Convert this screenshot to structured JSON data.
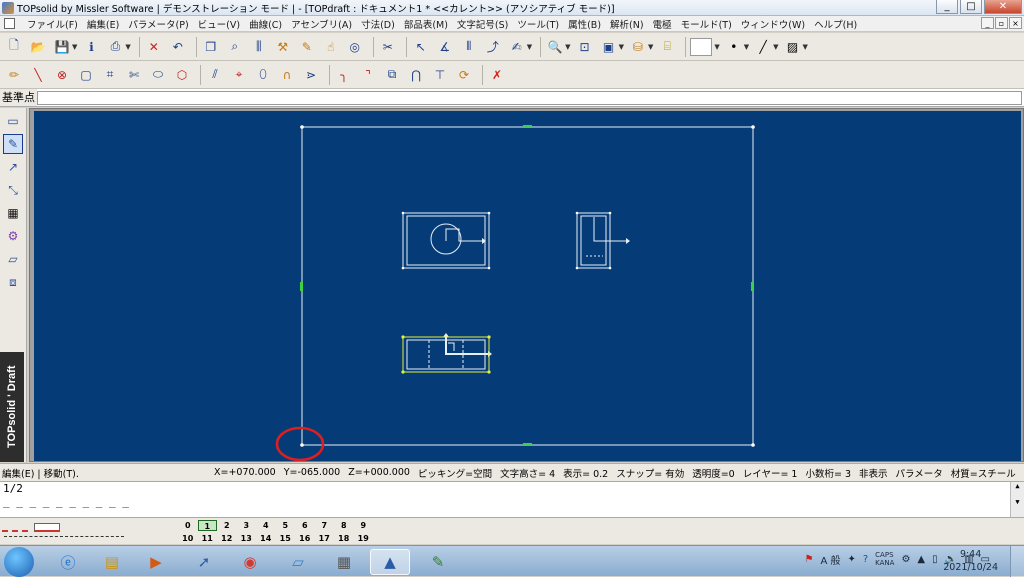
{
  "window": {
    "title": "TOPsolid by Missler Software | デモンストレーション モード | - [TOPdraft : ドキュメント1 *  <<カレント>> (アソシアティブ モード)]",
    "buttons": [
      "_",
      "□",
      "✕"
    ]
  },
  "menu": {
    "items": [
      "ファイル(F)",
      "編集(E)",
      "パラメータ(P)",
      "ビュー(V)",
      "曲線(C)",
      "アセンブリ(A)",
      "寸法(D)",
      "部品表(M)",
      "文字記号(S)",
      "ツール(T)",
      "属性(B)",
      "解析(N)",
      "電極",
      "モールド(T)",
      "ウィンドウ(W)",
      "ヘルプ(H)"
    ],
    "mdi_buttons": [
      "_",
      "▫",
      "×"
    ]
  },
  "toolbar1": {
    "icons": [
      "new-icon",
      "open-icon",
      "save-icon",
      "properties-icon",
      "print-icon",
      "delete-icon",
      "undo-icon",
      "copy-icon",
      "search-icon",
      "parameters-icon",
      "hammer-icon",
      "dimension-icon",
      "cursor-icon",
      "orbit-icon",
      "transform-icon",
      "line-icon",
      "angle-icon",
      "pins-icon",
      "hook-icon",
      "signature-icon",
      "zoom-icon",
      "frame-icon",
      "picture-icon",
      "view-icon",
      "cylinder-icon"
    ]
  },
  "toolbar2": {
    "icons": [
      "pencil-icon",
      "line-draw-icon",
      "circle-x-icon",
      "rectangle-icon",
      "crop-icon",
      "cut-icon",
      "ellipse-icon",
      "polygon-icon",
      "parallel-icon",
      "target-icon",
      "slot-icon",
      "arc-icon",
      "chamfer-icon",
      "fillet-icon",
      "corner-icon",
      "offset-icon",
      "bridge-icon",
      "trim-icon",
      "extend-icon",
      "cross-icon"
    ]
  },
  "command": {
    "label": "基準点",
    "value": ""
  },
  "sidebar": {
    "brand": "TOPsolid ' Draft",
    "icons": [
      "window-icon",
      "pencil-icon",
      "arrow-icon",
      "dimension-icon",
      "table-icon",
      "mesh-icon",
      "sheet-icon",
      "stack-icon"
    ]
  },
  "status": {
    "mode": "編集(E) | 移動(T).",
    "x": "X=+070.000",
    "y": "Y=-065.000",
    "z": "Z=+000.000",
    "picking": "ピッキング=空間",
    "text_height": "文字高さ=  4",
    "display": "表示=   0.2",
    "snap": "スナップ= 有効",
    "transparency": "透明度=0",
    "layer": "レイヤー=  1",
    "decimals": "小数桁= 3",
    "hidden": "非表示",
    "parameter": "パラメータ",
    "material": "材質=スチール"
  },
  "output": {
    "line1": "1/2",
    "line2": "_ _ _ _ _ _ _ _ _ _"
  },
  "layers": {
    "numbers": [
      "0",
      "1",
      "2",
      "3",
      "4",
      "5",
      "6",
      "7",
      "8",
      "9",
      "10",
      "11",
      "12",
      "13",
      "14",
      "15",
      "16",
      "17",
      "18",
      "19"
    ],
    "selected": "1"
  },
  "taskbar": {
    "apps": [
      "ie-icon",
      "explorer-icon",
      "media-icon",
      "rocket-icon",
      "chrome-icon",
      "notes-icon",
      "calculator-icon",
      "topsolid-icon",
      "paint-icon"
    ],
    "active": "topsolid-icon",
    "tray_ime": "A 般",
    "caps": "CAPS",
    "kana": "KANA",
    "time": "9:44",
    "date": "2021/10/24"
  },
  "colors": {
    "canvas": "#053c78",
    "drawing": "#e8eef6",
    "selected": "#e6ef3a",
    "handle": "#3fd04a",
    "annotation": "#e01e1e"
  }
}
